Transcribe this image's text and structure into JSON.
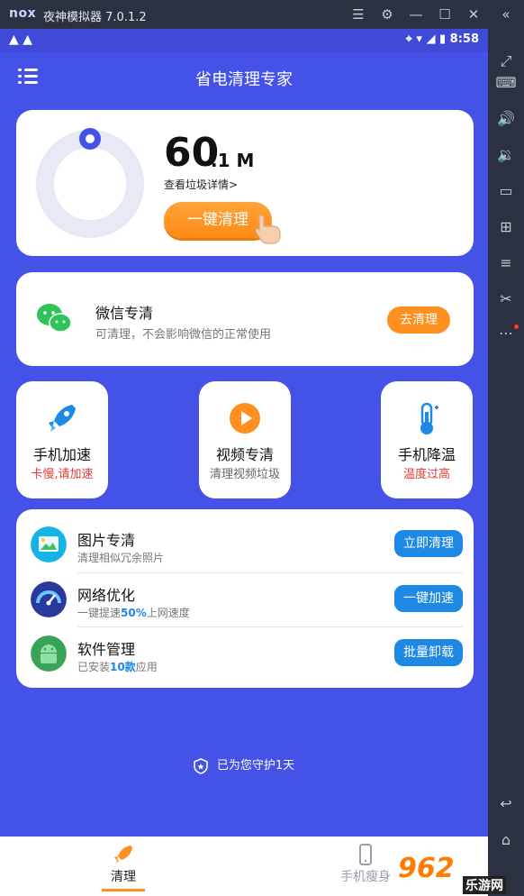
{
  "emulator": {
    "logo": "nox",
    "title": "夜神模拟器 7.0.1.2",
    "controls": [
      "menu-icon",
      "gear-icon",
      "minimize-icon",
      "maximize-icon",
      "close-icon",
      "collapse-icon"
    ],
    "sidebar_icons": [
      "fullscreen-icon",
      "keyboard-icon",
      "volume-up-icon",
      "volume-down-icon",
      "screen-icon",
      "apk-icon",
      "layers-icon",
      "scissors-icon",
      "more-icon",
      "back-icon",
      "home-icon"
    ]
  },
  "status_bar": {
    "time": "8:58"
  },
  "app": {
    "title": "省电清理专家"
  },
  "junk": {
    "size_value": "60",
    "size_unit": ".1 M",
    "detail_link": "查看垃圾详情>",
    "clean_button": "一键清理"
  },
  "wechat": {
    "title": "微信专清",
    "subtitle": "可清理，不会影响微信的正常使用",
    "button": "去清理"
  },
  "tiles": [
    {
      "title": "手机加速",
      "subtitle": "卡慢,请加速",
      "subtitle_color": "#e53935"
    },
    {
      "title": "视频专清",
      "subtitle": "清理视频垃圾",
      "subtitle_color": "#666666"
    },
    {
      "title": "手机降温",
      "subtitle": "温度过高",
      "subtitle_color": "#e53935"
    }
  ],
  "list": [
    {
      "title": "图片专清",
      "sub_pre": "清理相似冗余照片",
      "sub_hl": "",
      "sub_post": "",
      "button": "立即清理"
    },
    {
      "title": "网络优化",
      "sub_pre": "一键提速",
      "sub_hl": "50%",
      "sub_post": "上网速度",
      "button": "一键加速"
    },
    {
      "title": "软件管理",
      "sub_pre": "已安装",
      "sub_hl": "10款",
      "sub_post": "应用",
      "button": "批量卸载"
    }
  ],
  "guard_text": "已为您守护1天",
  "bottom_nav": [
    {
      "label": "清理",
      "active": true
    },
    {
      "label": "手机瘦身",
      "active": false
    }
  ],
  "watermark": {
    "main": "962",
    "sub": "乐游网"
  },
  "colors": {
    "primary": "#4552e8",
    "orange": "#ff8f1f",
    "blue_button": "#1e88e5",
    "alert_red": "#e53935"
  }
}
